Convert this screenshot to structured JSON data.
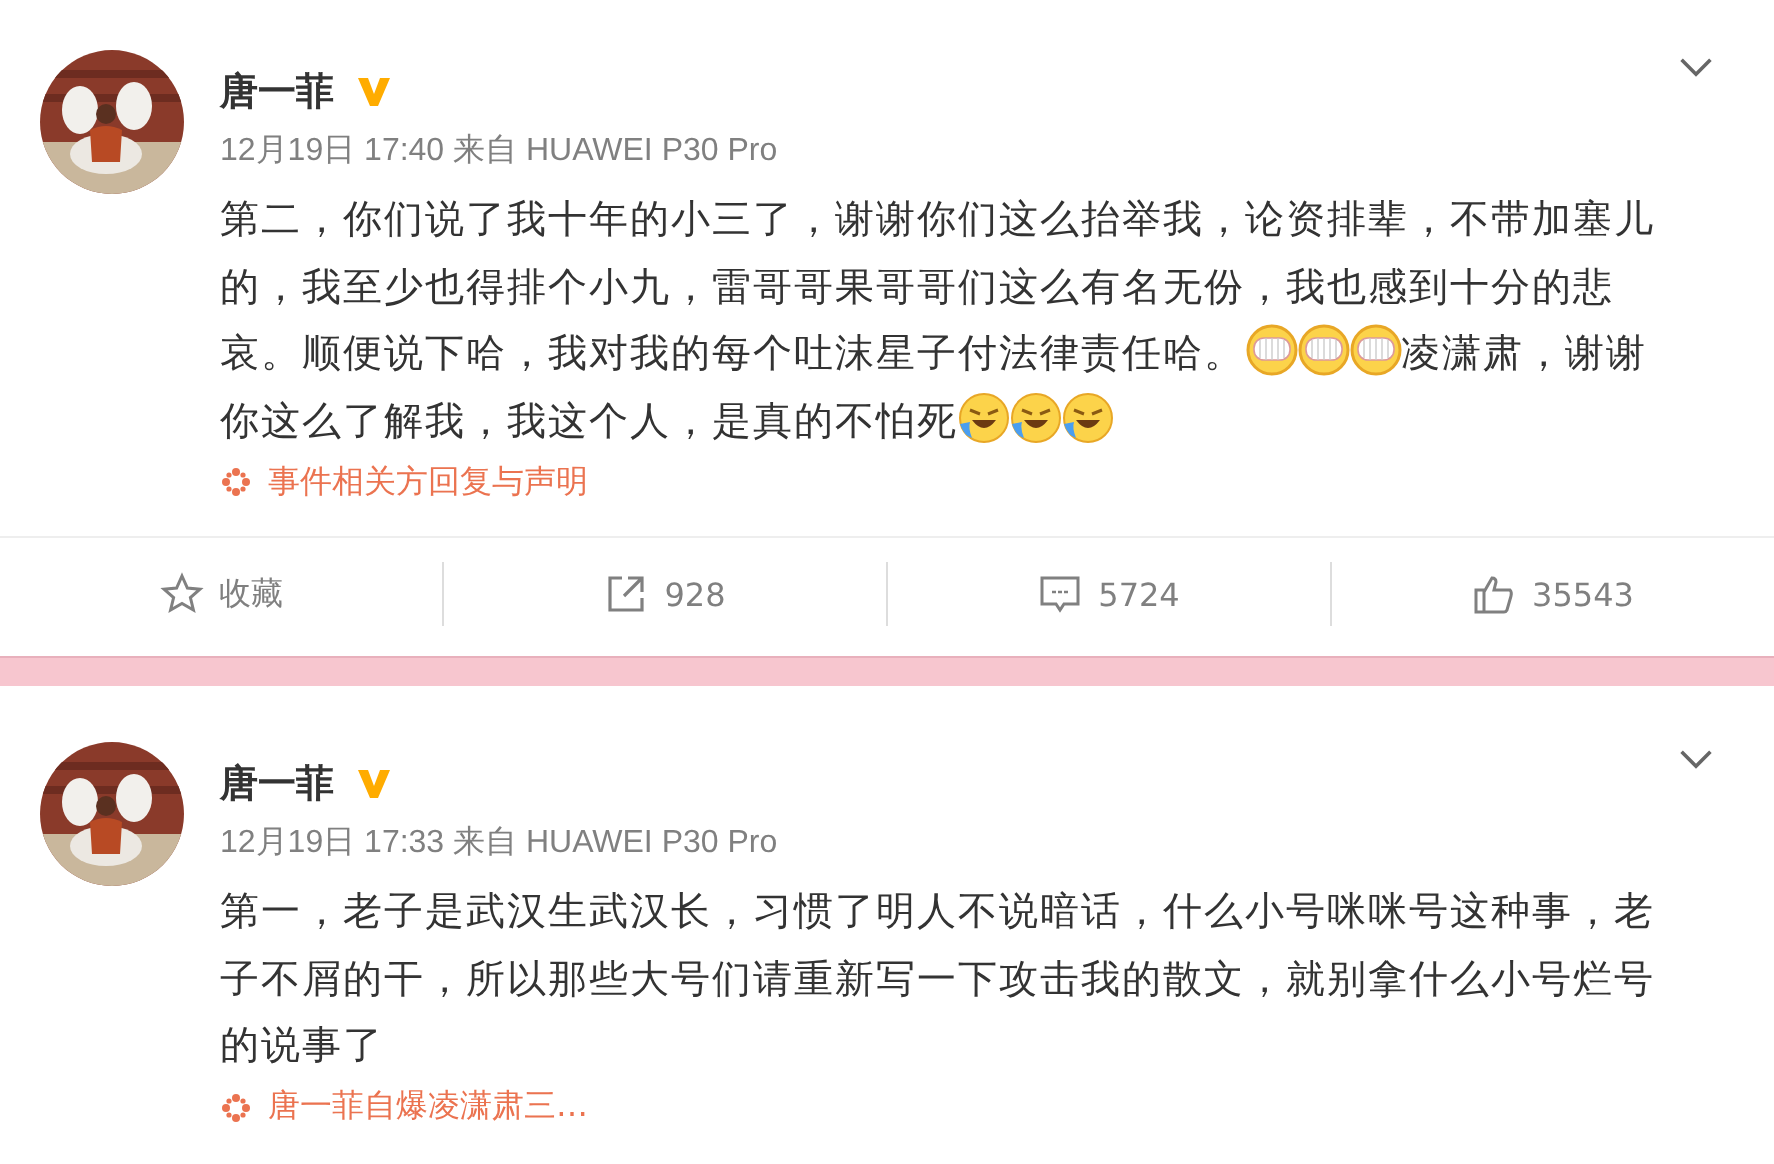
{
  "posts": [
    {
      "author": "唐一菲",
      "verified": true,
      "meta": "12月19日 17:40 来自 HUAWEI P30 Pro",
      "body_lines": [
        [
          {
            "kind": "text",
            "text": "第二，你们说了我十年的小三了，谢谢你们这么抬举我，论资排辈，不带加塞儿"
          }
        ],
        [
          {
            "kind": "text",
            "text": "的，我至少也得排个小九，雷哥哥果哥哥们这么有名无份，我也感到十分的悲"
          }
        ],
        [
          {
            "kind": "text",
            "text": "哀。顺便说下哈，我对我的每个吐沫星子付法律责任哈。"
          },
          {
            "kind": "grin"
          },
          {
            "kind": "grin"
          },
          {
            "kind": "grin"
          },
          {
            "kind": "text",
            "text": "凌潇肃，谢谢"
          }
        ],
        [
          {
            "kind": "text",
            "text": "你这么了解我，我这个人，是真的不怕死"
          },
          {
            "kind": "laugh-cry"
          },
          {
            "kind": "laugh-cry"
          },
          {
            "kind": "laugh-cry"
          }
        ]
      ],
      "source_link": "事件相关方回复与声明",
      "actions": [
        {
          "kind": "favorite",
          "label": "收藏"
        },
        {
          "kind": "repost",
          "label": "928"
        },
        {
          "kind": "comment",
          "label": "5724"
        },
        {
          "kind": "like",
          "label": "35543"
        }
      ]
    },
    {
      "author": "唐一菲",
      "verified": true,
      "meta": "12月19日 17:33 来自 HUAWEI P30 Pro",
      "body_lines": [
        [
          {
            "kind": "text",
            "text": "第一，老子是武汉生武汉长，习惯了明人不说暗话，什么小号咪咪号这种事，老"
          }
        ],
        [
          {
            "kind": "text",
            "text": "子不屑的干，所以那些大号们请重新写一下攻击我的散文，就别拿什么小号烂号"
          }
        ],
        [
          {
            "kind": "text",
            "text": "的说事了"
          }
        ]
      ],
      "source_link": "唐一菲自爆凌潇肃三…"
    }
  ]
}
